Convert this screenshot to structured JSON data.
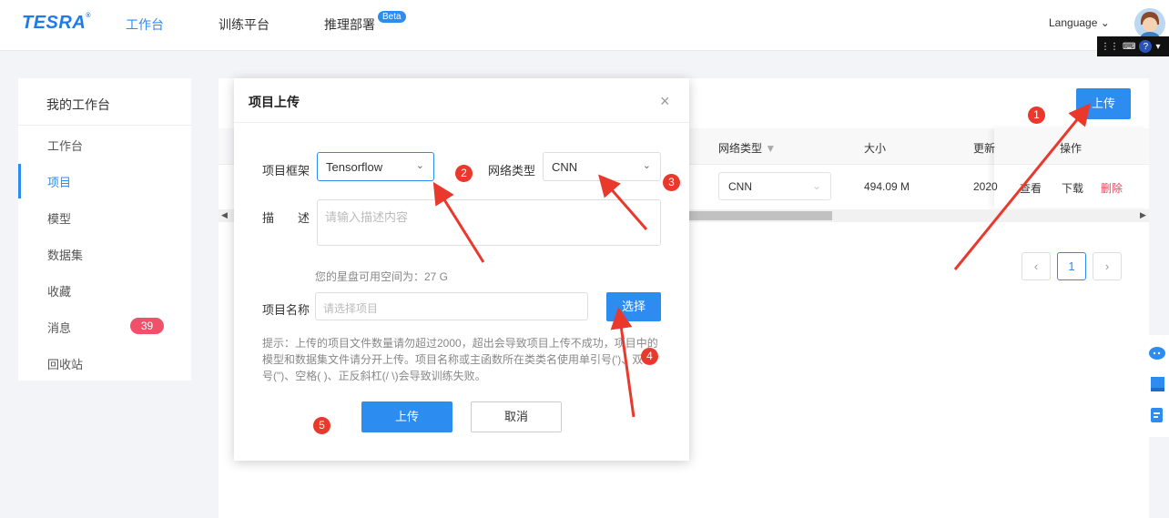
{
  "header": {
    "logo": "TESRA",
    "logo_mark": "®",
    "nav": [
      "工作台",
      "训练平台",
      "推理部署"
    ],
    "beta": "Beta",
    "language": "Language ⌄"
  },
  "sidebar": {
    "title": "我的工作台",
    "items": [
      "工作台",
      "项目",
      "模型",
      "数据集",
      "收藏",
      "消息",
      "回收站"
    ],
    "message_badge": "39"
  },
  "main": {
    "upload_button": "上传",
    "columns": {
      "network_type": "网络类型",
      "size": "大小",
      "updated": "更新",
      "actions": "操作"
    },
    "row": {
      "network_type": "CNN",
      "size": "494.09 M",
      "updated": "2020",
      "view": "查看",
      "download": "下载",
      "delete": "删除"
    },
    "pager": {
      "prev": "‹",
      "page": "1",
      "next": "›"
    }
  },
  "modal": {
    "title": "项目上传",
    "close": "×",
    "framework_label": "项目框架",
    "framework_value": "Tensorflow",
    "network_label": "网络类型",
    "network_value": "CNN",
    "desc_label": "描　　述",
    "desc_placeholder": "请输入描述内容",
    "space_hint": "您的星盘可用空间为：27 G",
    "name_label": "项目名称",
    "name_placeholder": "请选择项目",
    "choose_button": "选择",
    "tip": "提示：上传的项目文件数量请勿超过2000，超出会导致项目上传不成功，项目中的模型和数据集文件请分开上传。项目名称或主函数所在类类名使用单引号(')、双引号(\")、空格( )、正反斜杠(/ \\)会导致训练失败。",
    "upload_button": "上传",
    "cancel_button": "取消"
  },
  "annotations": [
    "1",
    "2",
    "3",
    "4",
    "5"
  ],
  "colors": {
    "accent": "#2d8cf0",
    "annotation": "#e9392d",
    "badge": "#f1506b"
  }
}
